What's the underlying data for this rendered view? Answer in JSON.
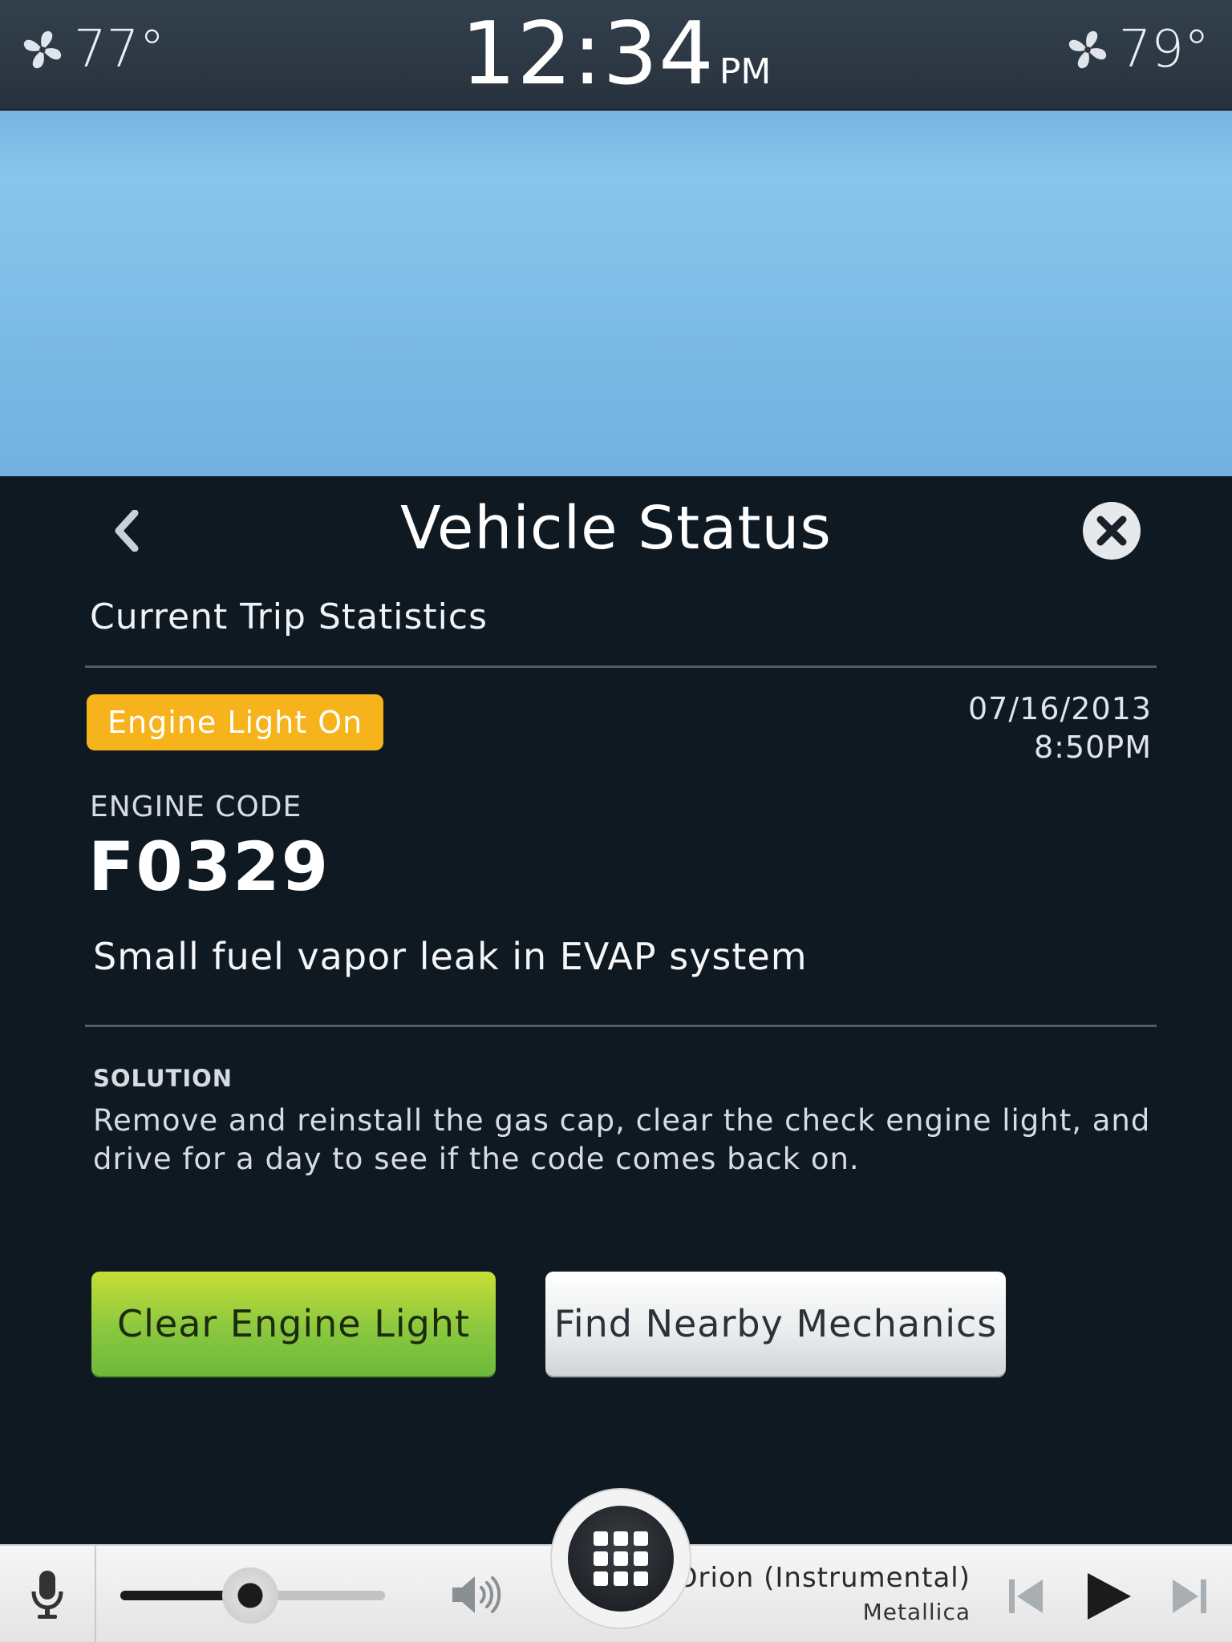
{
  "status_bar": {
    "left_temp": "77°",
    "right_temp": "79°",
    "time": "12:34",
    "ampm": "PM"
  },
  "panel": {
    "title": "Vehicle Status",
    "subheading": "Current Trip Statistics",
    "badge": "Engine Light On",
    "date": "07/16/2013",
    "time": "8:50PM",
    "engine_code_label": "ENGINE CODE",
    "engine_code": "F0329",
    "description": "Small fuel vapor leak in EVAP system",
    "solution_label": "SOLUTION",
    "solution_text": "Remove and reinstall the gas cap, clear the check engine light, and drive for a day to see if the code comes back on.",
    "clear_button": "Clear Engine Light",
    "mechanics_button": "Find Nearby Mechanics"
  },
  "media": {
    "track_title": "Orion (Instrumental)",
    "artist": "Metallica",
    "volume_fraction": 0.49
  },
  "colors": {
    "badge": "#f7b31b",
    "panel_bg": "#0f1922",
    "clear_button": "#8ac83f",
    "sky": "#80bfe8"
  },
  "icons": {
    "climate_left": "fan-icon",
    "climate_right": "fan-icon",
    "back": "chevron-left-icon",
    "close": "close-icon",
    "mic": "microphone-icon",
    "volume": "speaker-icon",
    "home": "grid-icon",
    "prev": "skip-back-icon",
    "play": "play-icon",
    "next": "skip-forward-icon"
  }
}
